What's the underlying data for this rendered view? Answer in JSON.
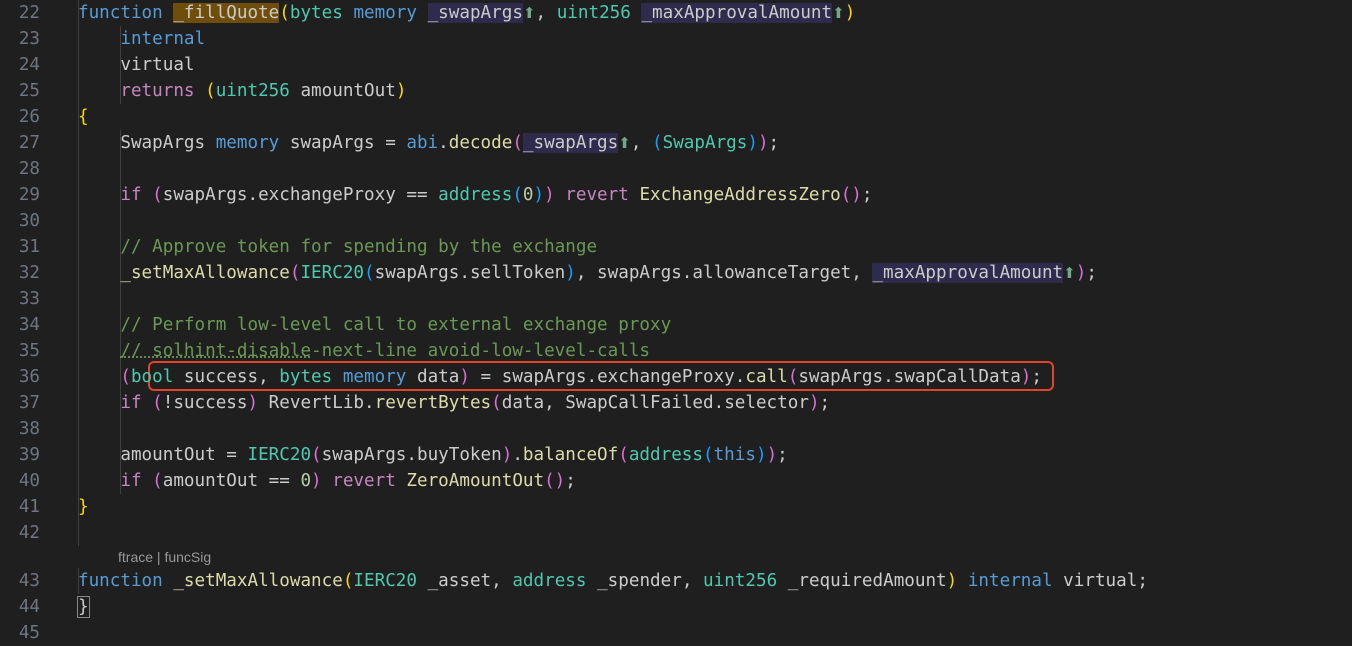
{
  "editor": {
    "line_numbers": [
      "22",
      "23",
      "24",
      "25",
      "26",
      "27",
      "28",
      "29",
      "30",
      "31",
      "32",
      "33",
      "34",
      "35",
      "36",
      "37",
      "38",
      "39",
      "40",
      "41",
      "42",
      "43",
      "44",
      "45"
    ],
    "codelens": {
      "ftrace": "ftrace",
      "separator": " | ",
      "funcsig": "funcSig"
    },
    "highlight_color": "#e0442b",
    "lines": [
      [
        [
          "kw",
          "function"
        ],
        [
          "vr",
          " "
        ],
        [
          "fnhl",
          "_fillQuote"
        ],
        [
          "p1",
          "("
        ],
        [
          "ty",
          "bytes"
        ],
        [
          "vr",
          " "
        ],
        [
          "kw",
          "memory"
        ],
        [
          "vr",
          " "
        ],
        [
          "param",
          "_swapArgs"
        ],
        [
          "up",
          "⬆"
        ],
        [
          "vr",
          ", "
        ],
        [
          "ty",
          "uint256"
        ],
        [
          "vr",
          " "
        ],
        [
          "param",
          "_maxApprovalAmount"
        ],
        [
          "up",
          "⬆"
        ],
        [
          "p1",
          ")"
        ]
      ],
      [
        [
          "vr",
          "    "
        ],
        [
          "kw",
          "internal"
        ]
      ],
      [
        [
          "vr",
          "    virtual"
        ]
      ],
      [
        [
          "vr",
          "    "
        ],
        [
          "ctl",
          "returns"
        ],
        [
          "vr",
          " "
        ],
        [
          "p1",
          "("
        ],
        [
          "ty",
          "uint256"
        ],
        [
          "vr",
          " amountOut"
        ],
        [
          "p1",
          ")"
        ]
      ],
      [
        [
          "p1",
          "{"
        ]
      ],
      [
        [
          "vr",
          "    SwapArgs "
        ],
        [
          "kw",
          "memory"
        ],
        [
          "vr",
          " swapArgs = "
        ],
        [
          "kw",
          "abi"
        ],
        [
          "vr",
          "."
        ],
        [
          "fn",
          "decode"
        ],
        [
          "p2",
          "("
        ],
        [
          "param",
          "_swapArgs"
        ],
        [
          "up",
          "⬆"
        ],
        [
          "vr",
          ", "
        ],
        [
          "p3",
          "("
        ],
        [
          "ty",
          "SwapArgs"
        ],
        [
          "p3",
          ")"
        ],
        [
          "p2",
          ")"
        ],
        [
          "vr",
          ";"
        ]
      ],
      [],
      [
        [
          "vr",
          "    "
        ],
        [
          "ctl",
          "if"
        ],
        [
          "vr",
          " "
        ],
        [
          "p2",
          "("
        ],
        [
          "vr",
          "swapArgs.exchangeProxy == "
        ],
        [
          "ty",
          "address"
        ],
        [
          "p3",
          "("
        ],
        [
          "num",
          "0"
        ],
        [
          "p3",
          ")"
        ],
        [
          "p2",
          ")"
        ],
        [
          "vr",
          " "
        ],
        [
          "ctl",
          "revert"
        ],
        [
          "vr",
          " "
        ],
        [
          "fn",
          "ExchangeAddressZero"
        ],
        [
          "p2",
          "()"
        ],
        [
          "vr",
          ";"
        ]
      ],
      [],
      [
        [
          "vr",
          "    "
        ],
        [
          "cm",
          "// Approve token for spending by the exchange"
        ]
      ],
      [
        [
          "vr",
          "    "
        ],
        [
          "fn",
          "_setMaxAllowance"
        ],
        [
          "p2",
          "("
        ],
        [
          "ty",
          "IERC20"
        ],
        [
          "p3",
          "("
        ],
        [
          "vr",
          "swapArgs.sellToken"
        ],
        [
          "p3",
          ")"
        ],
        [
          "vr",
          ", swapArgs.allowanceTarget, "
        ],
        [
          "param",
          "_maxApprovalAmount"
        ],
        [
          "up",
          "⬆"
        ],
        [
          "p2",
          ")"
        ],
        [
          "vr",
          ";"
        ]
      ],
      [],
      [
        [
          "vr",
          "    "
        ],
        [
          "cm",
          "// Perform low-level call to external exchange proxy"
        ]
      ],
      [
        [
          "vr",
          "    "
        ],
        [
          "cmlink",
          "// solhint-disable"
        ],
        [
          "cm",
          "-next-line avoid-low-level-calls"
        ]
      ],
      [
        [
          "vr",
          "    "
        ],
        [
          "p2",
          "("
        ],
        [
          "ty",
          "bool"
        ],
        [
          "vr",
          " success, "
        ],
        [
          "ty",
          "bytes"
        ],
        [
          "vr",
          " "
        ],
        [
          "kw",
          "memory"
        ],
        [
          "vr",
          " data"
        ],
        [
          "p2",
          ")"
        ],
        [
          "vr",
          " = swapArgs.exchangeProxy."
        ],
        [
          "fn",
          "call"
        ],
        [
          "p2",
          "("
        ],
        [
          "vr",
          "swapArgs.swapCallData"
        ],
        [
          "p2",
          ")"
        ],
        [
          "vr",
          ";"
        ]
      ],
      [
        [
          "vr",
          "    "
        ],
        [
          "ctl",
          "if"
        ],
        [
          "vr",
          " "
        ],
        [
          "p2",
          "("
        ],
        [
          "vr",
          "!success"
        ],
        [
          "p2",
          ")"
        ],
        [
          "vr",
          " RevertLib."
        ],
        [
          "fn",
          "revertBytes"
        ],
        [
          "p2",
          "("
        ],
        [
          "vr",
          "data, SwapCallFailed.selector"
        ],
        [
          "p2",
          ")"
        ],
        [
          "vr",
          ";"
        ]
      ],
      [],
      [
        [
          "vr",
          "    amountOut = "
        ],
        [
          "ty",
          "IERC20"
        ],
        [
          "p2",
          "("
        ],
        [
          "vr",
          "swapArgs.buyToken"
        ],
        [
          "p2",
          ")"
        ],
        [
          "vr",
          "."
        ],
        [
          "fn",
          "balanceOf"
        ],
        [
          "p2",
          "("
        ],
        [
          "ty",
          "address"
        ],
        [
          "p3",
          "("
        ],
        [
          "kw",
          "this"
        ],
        [
          "p3",
          ")"
        ],
        [
          "p2",
          ")"
        ],
        [
          "vr",
          ";"
        ]
      ],
      [
        [
          "vr",
          "    "
        ],
        [
          "ctl",
          "if"
        ],
        [
          "vr",
          " "
        ],
        [
          "p2",
          "("
        ],
        [
          "vr",
          "amountOut == "
        ],
        [
          "num",
          "0"
        ],
        [
          "p2",
          ")"
        ],
        [
          "vr",
          " "
        ],
        [
          "ctl",
          "revert"
        ],
        [
          "vr",
          " "
        ],
        [
          "fn",
          "ZeroAmountOut"
        ],
        [
          "p2",
          "()"
        ],
        [
          "vr",
          ";"
        ]
      ],
      [
        [
          "p1",
          "}"
        ]
      ],
      [],
      [
        [
          "kw",
          "function"
        ],
        [
          "vr",
          " "
        ],
        [
          "fn",
          "_setMaxAllowance"
        ],
        [
          "p1",
          "("
        ],
        [
          "ty",
          "IERC20"
        ],
        [
          "vr",
          " _asset, "
        ],
        [
          "ty",
          "address"
        ],
        [
          "vr",
          " _spender, "
        ],
        [
          "ty",
          "uint256"
        ],
        [
          "vr",
          " _requiredAmount"
        ],
        [
          "p1",
          ")"
        ],
        [
          "vr",
          " "
        ],
        [
          "kw",
          "internal"
        ],
        [
          "vr",
          " virtual;"
        ]
      ],
      [
        [
          "brk",
          "}"
        ]
      ],
      []
    ]
  }
}
